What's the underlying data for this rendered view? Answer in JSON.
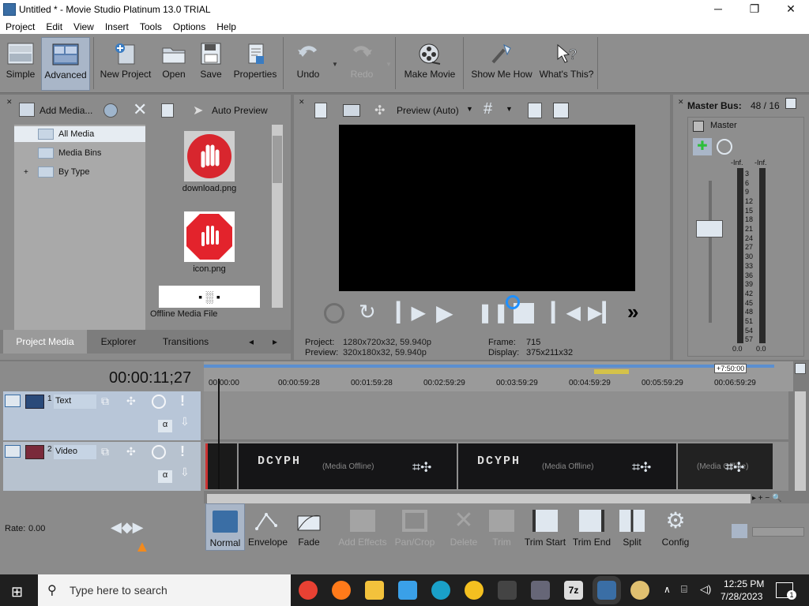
{
  "window": {
    "title": "Untitled * - Movie Studio Platinum 13.0 TRIAL",
    "minimize": "─",
    "maximize": "❐",
    "close": "✕"
  },
  "menu": [
    "Project",
    "Edit",
    "View",
    "Insert",
    "Tools",
    "Options",
    "Help"
  ],
  "toolbar": {
    "simple": "Simple",
    "advanced": "Advanced",
    "new_project": "New Project",
    "open": "Open",
    "save": "Save",
    "properties": "Properties",
    "undo": "Undo",
    "redo": "Redo",
    "make_movie": "Make Movie",
    "show_me_how": "Show Me How",
    "whats_this": "What's This?"
  },
  "media": {
    "add_media": "Add Media...",
    "auto_preview": "Auto Preview",
    "tree": [
      "All Media",
      "Media Bins",
      "By Type"
    ],
    "files": [
      {
        "name": "download.png",
        "icon": "stop-hand-icon"
      },
      {
        "name": "icon.png",
        "icon": "stop-hand-sign-icon"
      },
      {
        "name": "Offline Media File",
        "icon": "qr-code-icon"
      }
    ],
    "tabs": [
      "Project Media",
      "Explorer",
      "Transitions"
    ]
  },
  "preview": {
    "mode": "Preview (Auto)",
    "project_label": "Project:",
    "project_value": "1280x720x32, 59.940p",
    "preview_label": "Preview:",
    "preview_value": "320x180x32, 59.940p",
    "frame_label": "Frame:",
    "frame_value": "715",
    "display_label": "Display:",
    "display_value": "375x211x32"
  },
  "master": {
    "title": "Master Bus:",
    "value": "48 / 16",
    "label": "Master",
    "inf_left": "-Inf.",
    "inf_right": "-Inf.",
    "scale": [
      "3",
      "6",
      "9",
      "12",
      "15",
      "18",
      "21",
      "24",
      "27",
      "30",
      "33",
      "36",
      "39",
      "42",
      "45",
      "48",
      "51",
      "54",
      "57"
    ],
    "bottom_left": "0.0",
    "bottom_right": "0.0"
  },
  "timeline": {
    "timecode": "00:00:11;27",
    "end_marker": "+7:50:00",
    "ruler": [
      "00:00:00",
      "00:00:59:28",
      "00:01:59:28",
      "00:02:59:29",
      "00:03:59:29",
      "00:04:59:29",
      "00:05:59:29",
      "00:06:59:29"
    ],
    "tracks": [
      {
        "num": "1",
        "name": "Text",
        "alpha": "α"
      },
      {
        "num": "2",
        "name": "Video",
        "alpha": "α"
      }
    ],
    "clips": [
      {
        "title": "DCYPH",
        "status": "(Media Offline)"
      },
      {
        "title": "DCYPH",
        "status": "(Media Offline)"
      },
      {
        "title": "",
        "status": "(Media Offline)"
      }
    ]
  },
  "edit_tools": {
    "rate_label": "Rate:",
    "rate_value": "0.00",
    "normal": "Normal",
    "envelope": "Envelope",
    "fade": "Fade",
    "add_effects": "Add Effects",
    "pan_crop": "Pan/Crop",
    "delete": "Delete",
    "trim": "Trim",
    "trim_start": "Trim Start",
    "trim_end": "Trim End",
    "split": "Split",
    "config": "Config"
  },
  "taskbar": {
    "search_placeholder": "Type here to search",
    "time": "12:25 PM",
    "date": "7/28/2023",
    "notifications": "1"
  }
}
